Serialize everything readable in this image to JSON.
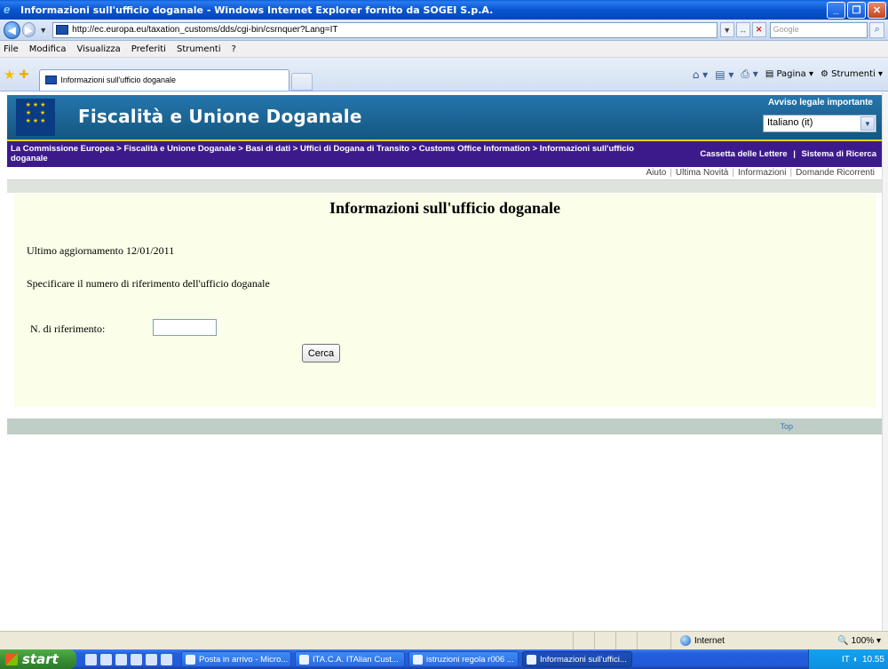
{
  "window": {
    "title": "Informazioni sull'ufficio doganale - Windows Internet Explorer fornito da SOGEI S.p.A."
  },
  "address": {
    "url": "http://ec.europa.eu/taxation_customs/dds/cgi-bin/csrnquer?Lang=IT",
    "search_placeholder": "Google"
  },
  "menu": [
    "File",
    "Modifica",
    "Visualizza",
    "Preferiti",
    "Strumenti",
    "?"
  ],
  "tab": {
    "label": "Informazioni sull'ufficio doganale"
  },
  "commandbar": {
    "page_label": "Pagina",
    "tools_label": "Strumenti"
  },
  "header": {
    "site_title": "Fiscalità e Unione Doganale",
    "legal_notice": "Avviso legale importante",
    "language_selected": "Italiano (it)"
  },
  "breadcrumb": {
    "path": "La Commissione Europea > Fiscalità e Unione Doganale > Basi di dati > Uffici di Dogana di Transito > Customs Office Information > Informazioni sull'ufficio doganale",
    "mailbox": "Cassetta delle Lettere",
    "search_system": "Sistema di Ricerca",
    "separator": "|"
  },
  "help_links": [
    "Aiuto",
    "Ultima Novità",
    "Informazioni",
    "Domande Ricorrenti"
  ],
  "content": {
    "title": "Informazioni sull'ufficio doganale",
    "last_update": "Ultimo aggiornamento 12/01/2011",
    "instruction": "Specificare il numero di riferimento dell'ufficio doganale",
    "reference_label": "N. di riferimento:",
    "reference_value": "",
    "search_button": "Cerca"
  },
  "footer": {
    "top_link": "Top"
  },
  "statusbar": {
    "zone": "Internet",
    "zoom": "100%"
  },
  "taskbar": {
    "start_label": "start",
    "buttons": [
      "Posta in arrivo - Micro...",
      "ITA.C.A. ITAlian Cust...",
      "istruzioni regola r006 ...",
      "Informazioni sull'uffici..."
    ],
    "tray_lang": "IT",
    "clock": "10.55"
  }
}
